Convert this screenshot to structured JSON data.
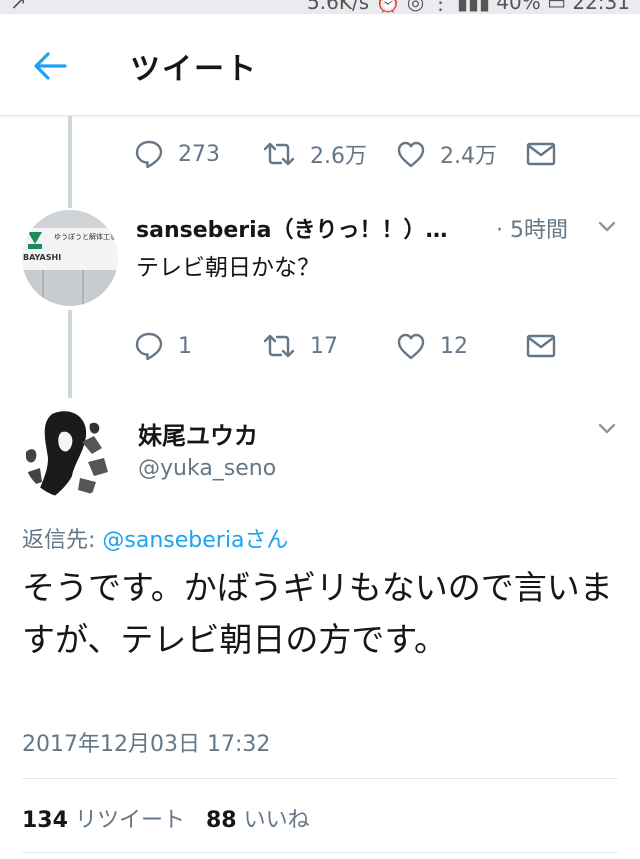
{
  "status_bar": {
    "left_text": "↗",
    "right_text": "5.6K/s  ⏰  ◎  ⋮  ▮▮▮ 40%  ▭  22:31"
  },
  "app_bar": {
    "title": "ツイート",
    "back_icon": "arrow-left-icon"
  },
  "previous_tweet_actions": {
    "replies": "273",
    "retweets": "2.6万",
    "likes": "2.4万"
  },
  "reply_tweet": {
    "name": "sanseberia（きりっ！！）…",
    "time": "· 5時間",
    "text": "テレビ朝日かな？",
    "avatar_sign_top": "ゆうぽうと解体工事",
    "avatar_sign_left": "BAYASHI",
    "replies": "1",
    "retweets": "17",
    "likes": "12"
  },
  "main_tweet": {
    "name": "妹尾ユウカ",
    "handle": "@yuka_seno",
    "replying_prefix": "返信先: ",
    "replying_mention": "@sanseberiaさん",
    "text": "そうです。かばうギリもないので言いますが、テレビ朝日の方です。",
    "timestamp": "2017年12月03日 17:32",
    "retweet_count": "134",
    "retweet_label": "リツイート",
    "like_count": "88",
    "like_label": "いいね"
  },
  "colors": {
    "accent": "#1da1f2",
    "secondary_text": "#657786",
    "primary_text": "#14171a",
    "thread_line": "#ccd6dd"
  }
}
